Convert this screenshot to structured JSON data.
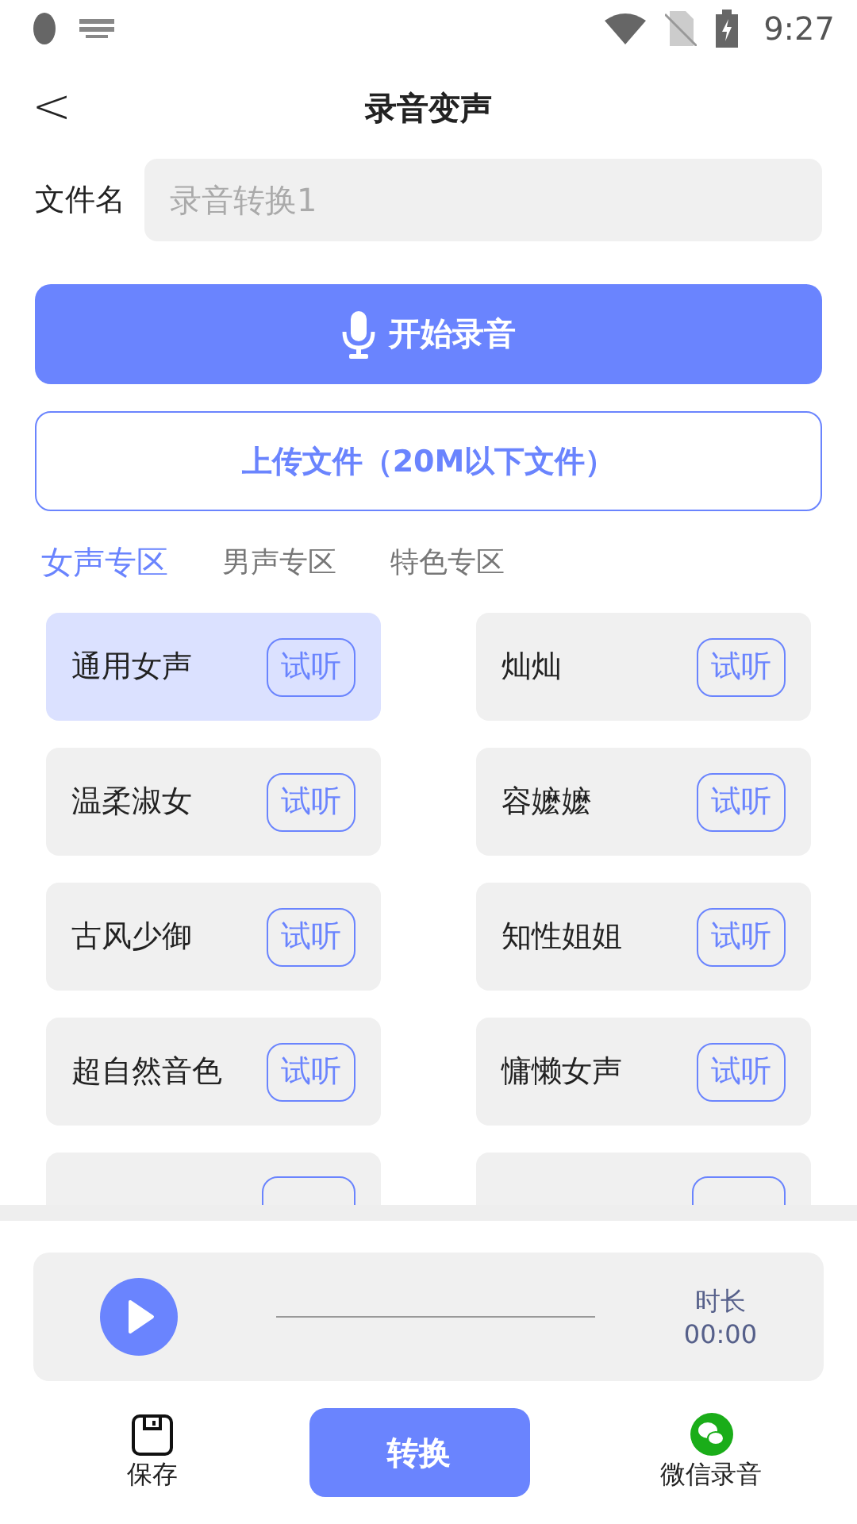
{
  "status_bar": {
    "time": "9:27"
  },
  "header": {
    "back": "<",
    "title": "录音变声"
  },
  "file_name": {
    "label": "文件名",
    "placeholder": "录音转换1"
  },
  "record_button": "开始录音",
  "upload_button": "上传文件（20M以下文件）",
  "tabs": [
    {
      "label": "女声专区",
      "selected": true
    },
    {
      "label": "男声专区",
      "selected": false
    },
    {
      "label": "特色专区",
      "selected": false
    }
  ],
  "voices": [
    {
      "name": "通用女声",
      "action": "试听",
      "selected": true
    },
    {
      "name": "灿灿",
      "action": "试听",
      "selected": false
    },
    {
      "name": "温柔淑女",
      "action": "试听",
      "selected": false
    },
    {
      "name": "容嬷嬷",
      "action": "试听",
      "selected": false
    },
    {
      "name": "古风少御",
      "action": "试听",
      "selected": false
    },
    {
      "name": "知性姐姐",
      "action": "试听",
      "selected": false
    },
    {
      "name": "超自然音色",
      "action": "试听",
      "selected": false
    },
    {
      "name": "慵懒女声",
      "action": "试听",
      "selected": false
    },
    {
      "kind": "partial",
      "selected": false
    },
    {
      "kind": "partial",
      "selected": false
    }
  ],
  "player": {
    "duration_label": "时长",
    "duration": "00:00"
  },
  "bottom_bar": {
    "save": "保存",
    "convert": "转换",
    "wechat": "微信录音"
  }
}
